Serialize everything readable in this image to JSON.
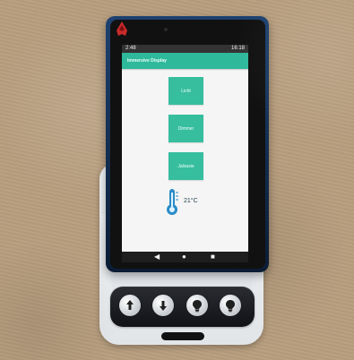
{
  "status_bar": {
    "left_text": "2:48",
    "right_text": "16:18"
  },
  "app": {
    "title": "Immersive Display"
  },
  "buttons": [
    {
      "label": "Licht"
    },
    {
      "label": "Dimmer"
    },
    {
      "label": "Jalousie"
    }
  ],
  "temperature": {
    "value": "21°C",
    "icon": "thermometer-icon"
  },
  "nav_bar": {
    "back": "◀",
    "home": "●",
    "recent": "■"
  },
  "icons": {
    "logo": "logo-icon",
    "up": "arrow-up-icon",
    "down": "arrow-down-icon",
    "bulb_1": "bulb-icon",
    "bulb_2": "bulb-icon"
  },
  "colors": {
    "accent": "#36be9f",
    "header": "#2fb99b",
    "temperature_icon": "#2a8cc8"
  }
}
